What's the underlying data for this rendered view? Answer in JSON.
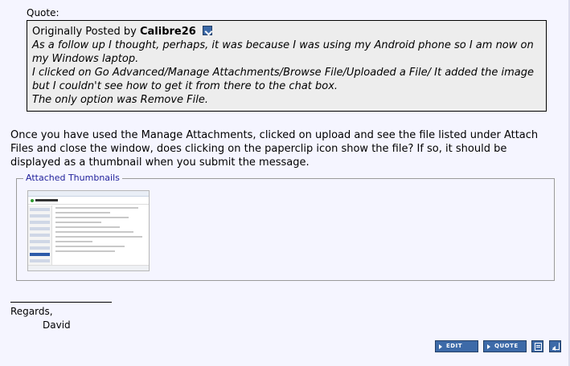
{
  "quote": {
    "label": "Quote:",
    "head_prefix": "Originally Posted by",
    "author": "Calibre26",
    "lines": [
      "As a follow up I thought, perhaps, it was because I was using my Android phone so I am now on my Windows laptop.",
      "I clicked on Go Advanced/Manage Attachments/Browse File/Uploaded a File/ It added the image but I couldn't see how to get it from there to the chat box.",
      "The only option was Remove File."
    ]
  },
  "message": {
    "text": "Once you have used the Manage Attachments, clicked on upload and see the file listed under Attach Files and close the window, does clicking on the paperclip icon show the file? If so, it should be displayed as a thumbnail when you submit the message."
  },
  "attachments": {
    "legend": "Attached Thumbnails"
  },
  "signature": {
    "line1": "Regards,",
    "line2": "David"
  },
  "buttons": {
    "edit": "EDIT",
    "quote": "QUOTE"
  },
  "icons": {
    "view_post": "view-post-icon",
    "multiquote": "multiquote-icon",
    "reply": "quick-reply-icon"
  },
  "colors": {
    "page_bg": "#f5f5ff",
    "quote_bg": "#ededed",
    "button_bg": "#3d6aa8",
    "legend_text": "#22229c"
  }
}
